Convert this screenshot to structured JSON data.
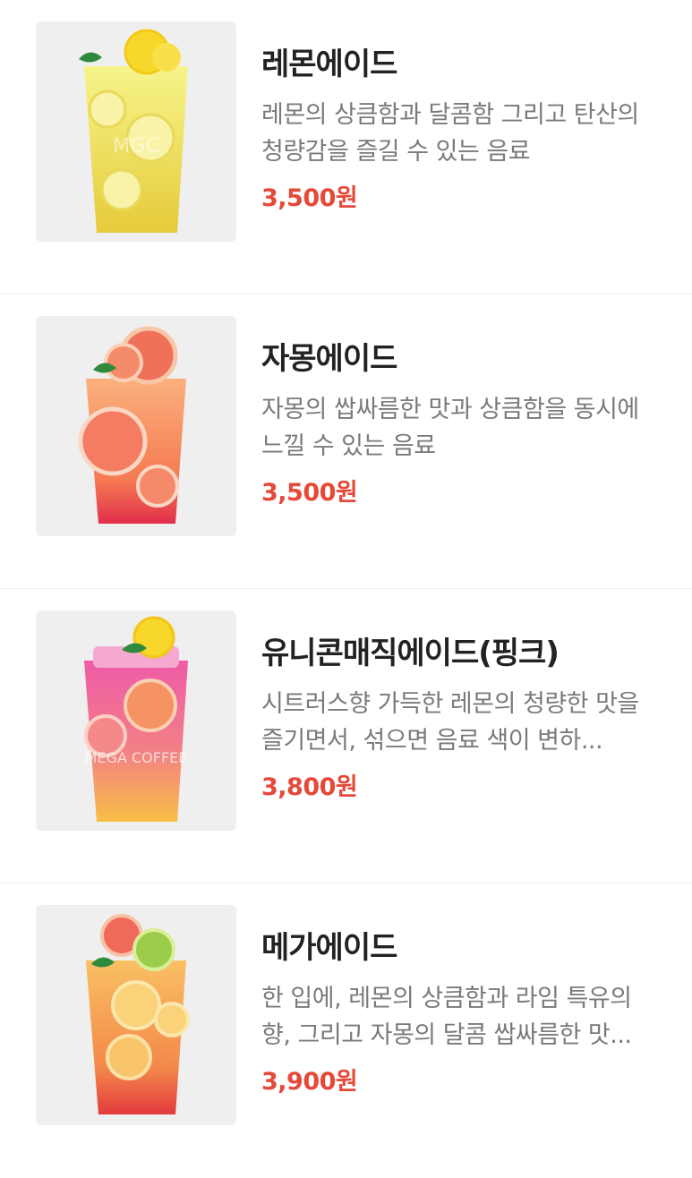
{
  "menu": {
    "items": [
      {
        "name": "레몬에이드",
        "description": "레몬의 상큼함과 달콤함 그리고 탄산의 청량감을 즐길 수 있는 음료",
        "price": "3,500원",
        "image_icon": "lemonade-drink-image",
        "colors": {
          "top": "#f3f07a",
          "bottom": "#e8cf3e"
        }
      },
      {
        "name": "자몽에이드",
        "description": "자몽의 쌉싸름한 맛과 상큼함을 동시에 느낄 수 있는 음료",
        "price": "3,500원",
        "image_icon": "grapefruit-ade-drink-image",
        "colors": {
          "top": "#f9a77a",
          "bottom": "#e8304c"
        }
      },
      {
        "name": "유니콘매직에이드(핑크)",
        "description": "시트러스향 가득한 레몬의 청량한 맛을 즐기면서, 섞으면 음료 색이 변하...",
        "price": "3,800원",
        "image_icon": "unicorn-magic-ade-drink-image",
        "colors": {
          "top": "#ee5fa6",
          "bottom": "#f8b44a"
        }
      },
      {
        "name": "메가에이드",
        "description": "한 입에, 레몬의 상큼함과 라임 특유의 향, 그리고 자몽의 달콤 쌉싸름한 맛...",
        "price": "3,900원",
        "image_icon": "mega-ade-drink-image",
        "colors": {
          "top": "#f7b24f",
          "bottom": "#e83a3c"
        }
      }
    ]
  }
}
